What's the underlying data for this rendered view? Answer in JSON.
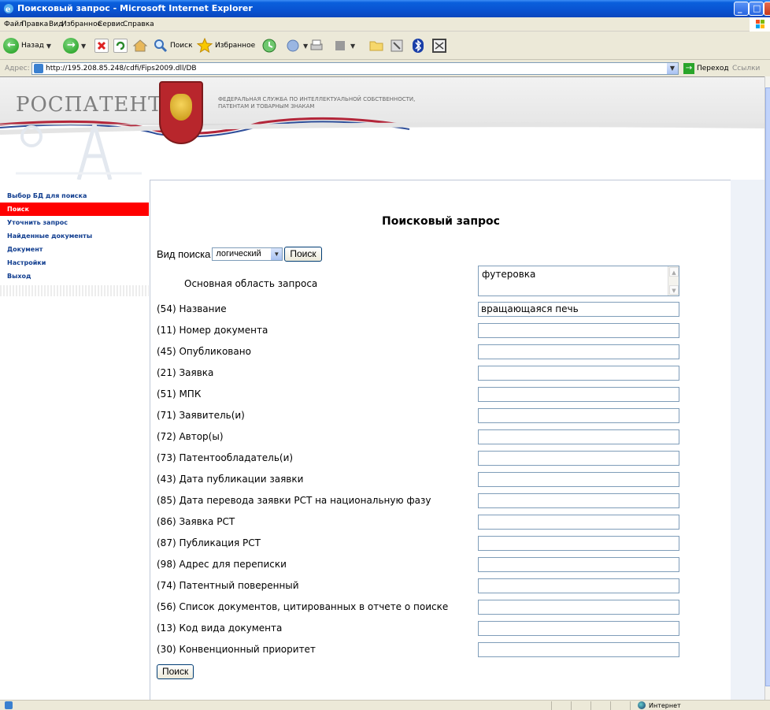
{
  "window": {
    "title": "Поисковый запрос - Microsoft Internet Explorer"
  },
  "menu": [
    "Файл",
    "Правка",
    "Вид",
    "Избранное",
    "Сервис",
    "Справка"
  ],
  "toolbar": {
    "back_label": "Назад",
    "search_label": "Поиск",
    "favorites_label": "Избранное"
  },
  "address": {
    "label": "Адрес:",
    "url": "http://195.208.85.248/cdfi/Fips2009.dll/DB",
    "go_label": "Переход",
    "links_label": "Ссылки"
  },
  "banner": {
    "logo_text": "РОСПАТЕНТ",
    "agency_line1": "ФЕДЕРАЛЬНАЯ СЛУЖБА ПО ИНТЕЛЛЕКТУАЛЬНОЙ СОБСТВЕННОСТИ,",
    "agency_line2": "ПАТЕНТАМ И ТОВАРНЫМ ЗНАКАМ"
  },
  "nav": {
    "items": [
      {
        "label": "Выбор БД для поиска",
        "active": false
      },
      {
        "label": "Поиск",
        "active": true
      },
      {
        "label": "Уточнить запрос",
        "active": false
      },
      {
        "label": "Найденные документы",
        "active": false
      },
      {
        "label": "Документ",
        "active": false
      },
      {
        "label": "Настройки",
        "active": false
      },
      {
        "label": "Выход",
        "active": false
      }
    ]
  },
  "form": {
    "heading": "Поисковый запрос",
    "search_type_label": "Вид поиска",
    "search_type_value": "логический",
    "search_button": "Поиск",
    "main_area_label": "Основная область запроса",
    "main_area_value": "футеровка",
    "fields": [
      {
        "label": "(54) Название",
        "value": "вращающаяся печь"
      },
      {
        "label": "(11) Номер документа",
        "value": ""
      },
      {
        "label": "(45) Опубликовано",
        "value": ""
      },
      {
        "label": "(21) Заявка",
        "value": ""
      },
      {
        "label": "(51) МПК",
        "value": ""
      },
      {
        "label": "(71) Заявитель(и)",
        "value": ""
      },
      {
        "label": "(72) Автор(ы)",
        "value": ""
      },
      {
        "label": "(73) Патентообладатель(и)",
        "value": ""
      },
      {
        "label": "(43) Дата публикации заявки",
        "value": ""
      },
      {
        "label": "(85) Дата перевода заявки PCT на национальную фазу",
        "value": ""
      },
      {
        "label": "(86) Заявка PCT",
        "value": ""
      },
      {
        "label": "(87) Публикация PCT",
        "value": ""
      },
      {
        "label": "(98) Адрес для переписки",
        "value": ""
      },
      {
        "label": "(74) Патентный поверенный",
        "value": ""
      },
      {
        "label": "(56) Список документов, цитированных в отчете о поиске",
        "value": ""
      },
      {
        "label": "(13) Код вида документа",
        "value": ""
      },
      {
        "label": "(30) Конвенционный приоритет",
        "value": ""
      }
    ],
    "bottom_button": "Поиск"
  },
  "status": {
    "zone_label": "Интернет"
  },
  "colors": {
    "nav_active_bg": "#ff0000",
    "nav_text": "#103d8f",
    "titlebar": "#0953d1"
  }
}
